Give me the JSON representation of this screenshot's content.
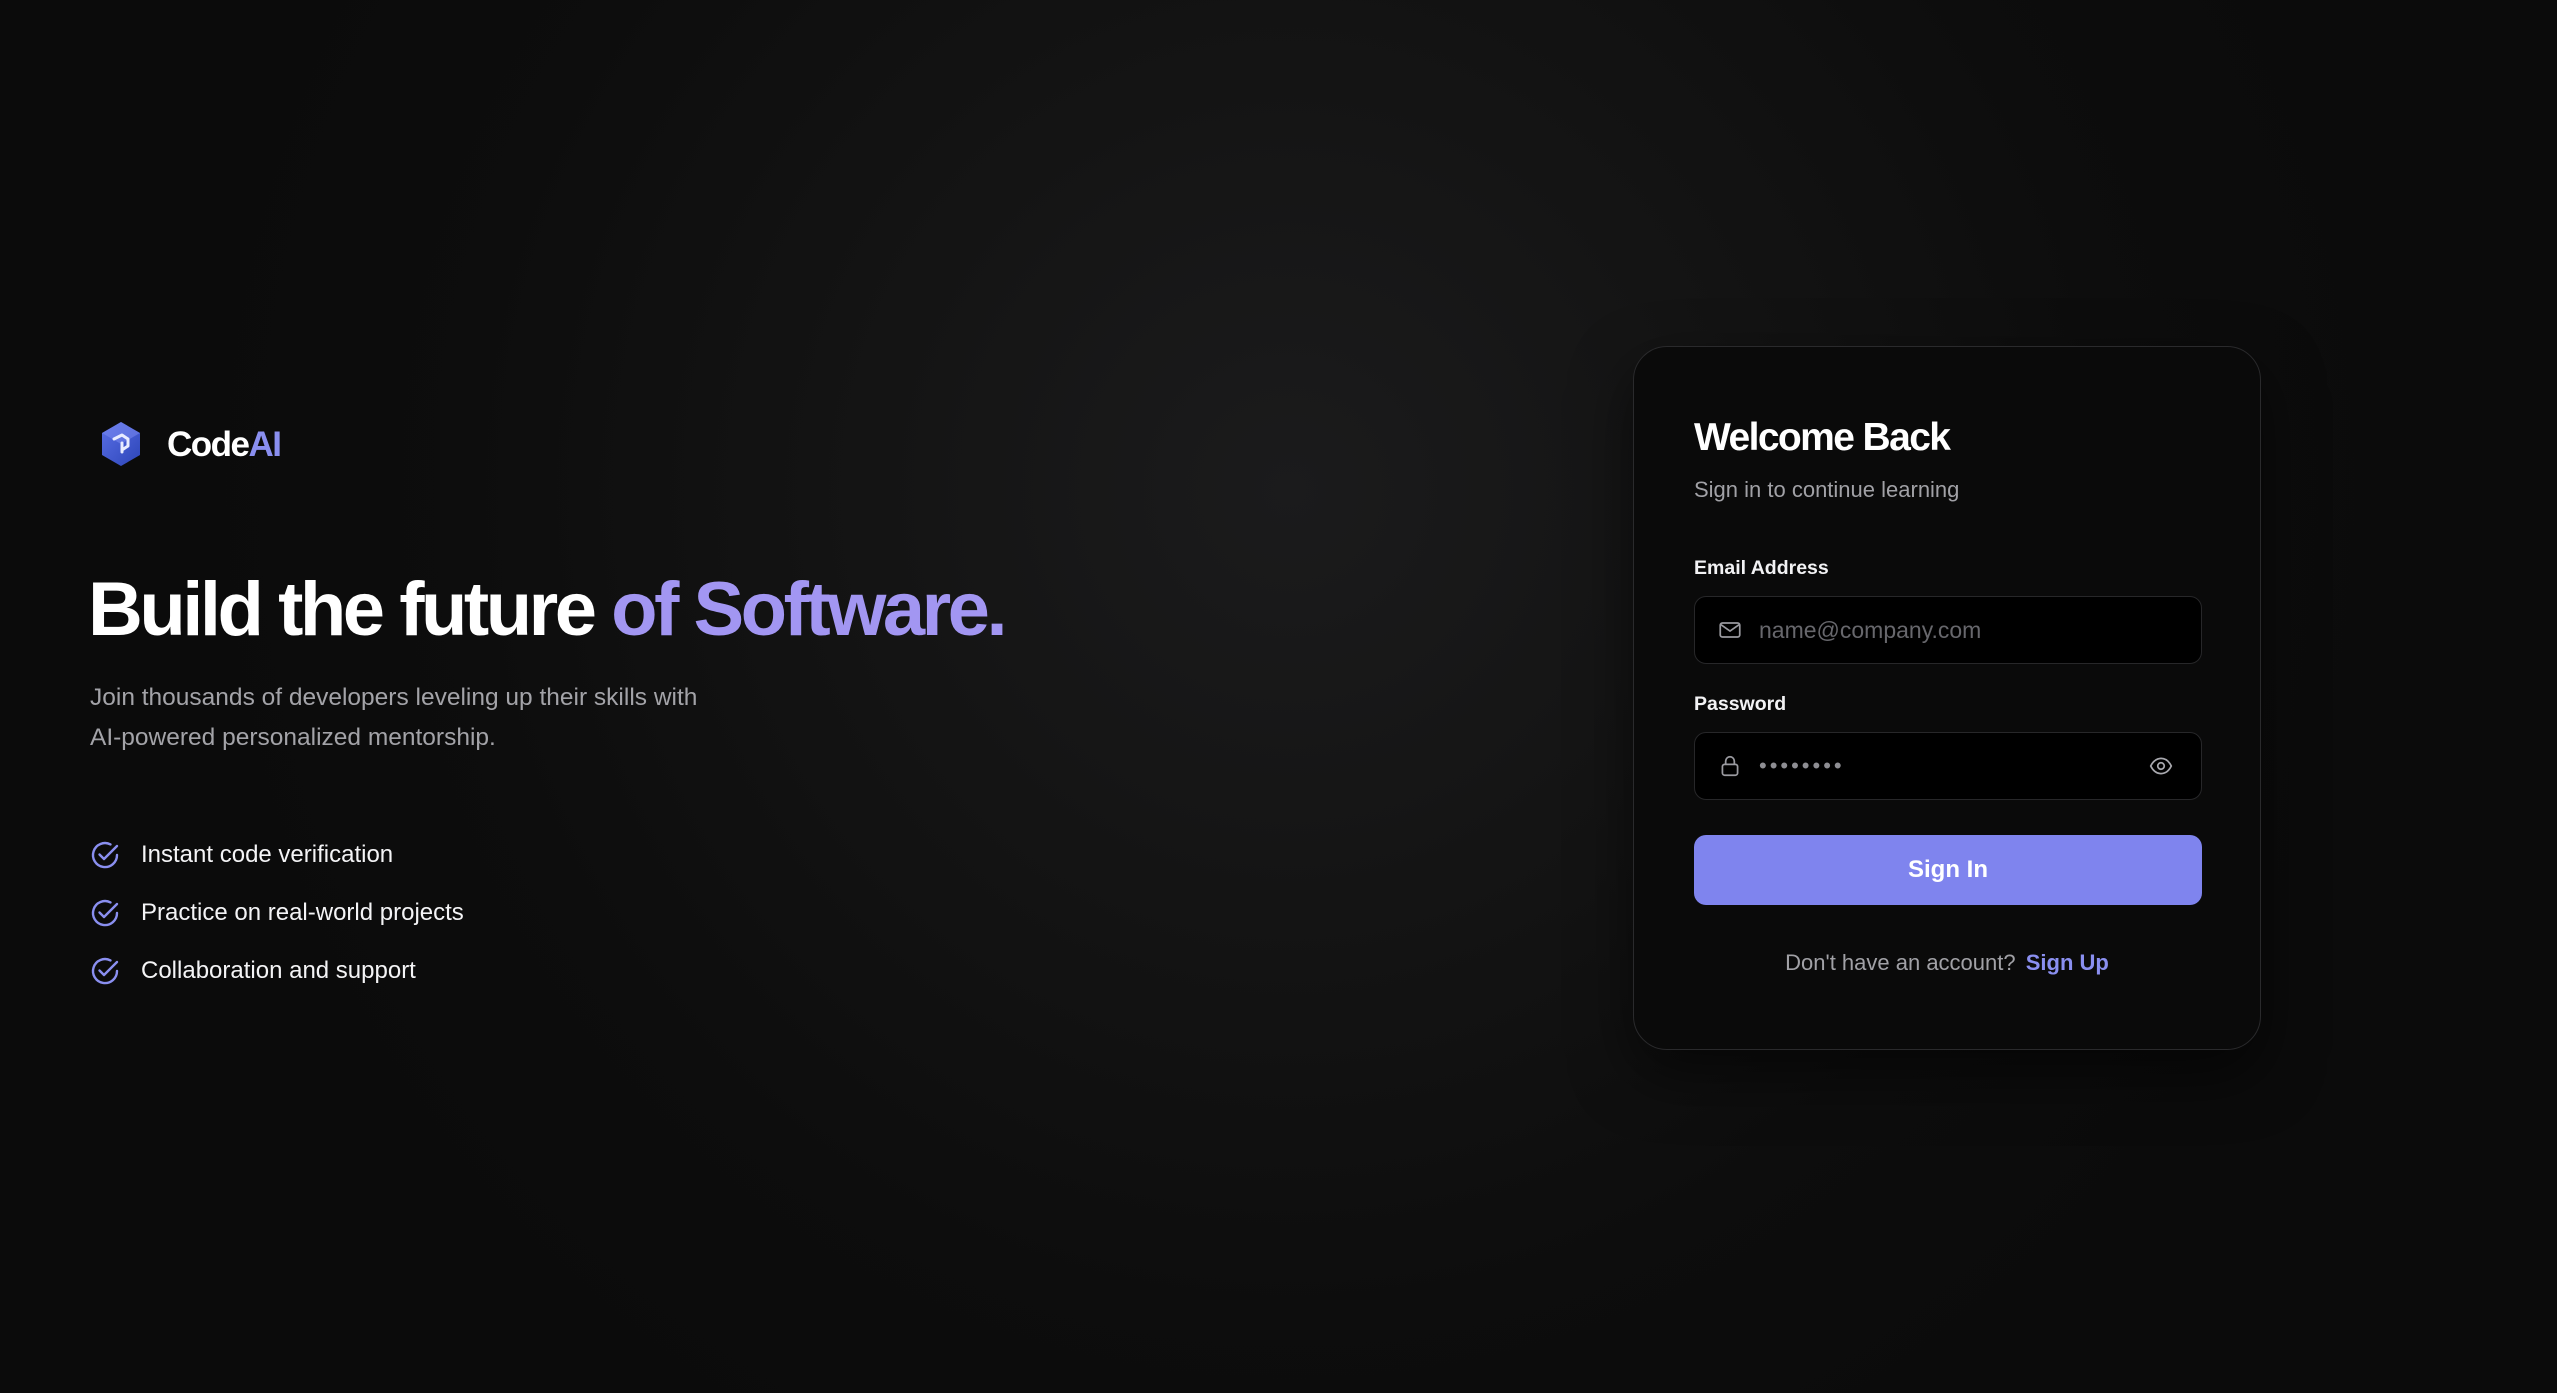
{
  "brand": {
    "name_primary": "Code",
    "name_accent": "AI",
    "logo_icon": "hexagon-logo-icon"
  },
  "hero": {
    "title_primary": "Build the future",
    "title_accent": "of Software.",
    "subtitle_line1": "Join thousands of developers leveling up their skills with",
    "subtitle_line2": "AI-powered personalized mentorship."
  },
  "features": [
    {
      "label": "Instant code verification",
      "icon": "check-circle-icon"
    },
    {
      "label": "Practice on real-world projects",
      "icon": "check-circle-icon"
    },
    {
      "label": "Collaboration and support",
      "icon": "check-circle-icon"
    }
  ],
  "login": {
    "title": "Welcome Back",
    "subtitle": "Sign in to continue learning",
    "email_label": "Email Address",
    "email_placeholder": "name@company.com",
    "email_value": "",
    "email_icon": "mail-icon",
    "password_label": "Password",
    "password_value": "••••••••",
    "password_icon": "lock-icon",
    "toggle_icon": "eye-icon",
    "submit_label": "Sign In",
    "signup_prompt": "Don't have an account?",
    "signup_link": "Sign Up"
  },
  "colors": {
    "accent": "#7f84ee",
    "accent_text": "#a296f2",
    "background": "#0d0d0d",
    "card": "#0a0a0a"
  }
}
